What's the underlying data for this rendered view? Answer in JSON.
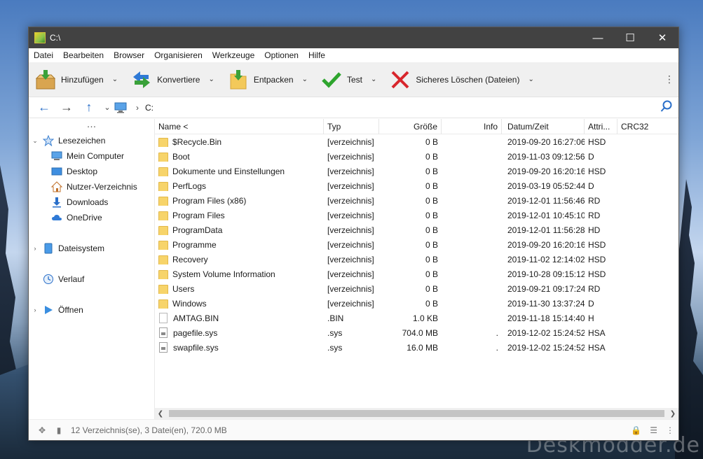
{
  "window": {
    "title": "C:\\"
  },
  "menu": [
    "Datei",
    "Bearbeiten",
    "Browser",
    "Organisieren",
    "Werkzeuge",
    "Optionen",
    "Hilfe"
  ],
  "toolbar": {
    "add_label": "Hinzufügen",
    "convert_label": "Konvertiere",
    "extract_label": "Entpacken",
    "test_label": "Test",
    "delete_label": "Sicheres Löschen (Dateien)"
  },
  "nav": {
    "path": "C:"
  },
  "sidebar": {
    "bookmarks": "Lesezeichen",
    "items": [
      "Mein Computer",
      "Desktop",
      "Nutzer-Verzeichnis",
      "Downloads",
      "OneDrive"
    ],
    "filesystem": "Dateisystem",
    "history": "Verlauf",
    "open": "Öffnen"
  },
  "columns": {
    "name": "Name <",
    "type": "Typ",
    "size": "Größe",
    "info": "Info",
    "date": "Datum/Zeit",
    "attr": "Attri...",
    "crc": "CRC32"
  },
  "files": [
    {
      "name": "$Recycle.Bin",
      "type": "[verzeichnis]",
      "size": "0 B",
      "info": "",
      "date": "2019-09-20 16:27:06",
      "attr": "HSD",
      "kind": "folder"
    },
    {
      "name": "Boot",
      "type": "[verzeichnis]",
      "size": "0 B",
      "info": "",
      "date": "2019-11-03 09:12:56",
      "attr": "D",
      "kind": "folder"
    },
    {
      "name": "Dokumente und Einstellungen",
      "type": "[verzeichnis]",
      "size": "0 B",
      "info": "",
      "date": "2019-09-20 16:20:16",
      "attr": "HSD",
      "kind": "folder"
    },
    {
      "name": "PerfLogs",
      "type": "[verzeichnis]",
      "size": "0 B",
      "info": "",
      "date": "2019-03-19 05:52:44",
      "attr": "D",
      "kind": "folder"
    },
    {
      "name": "Program Files (x86)",
      "type": "[verzeichnis]",
      "size": "0 B",
      "info": "",
      "date": "2019-12-01 11:56:46",
      "attr": "RD",
      "kind": "folder"
    },
    {
      "name": "Program Files",
      "type": "[verzeichnis]",
      "size": "0 B",
      "info": "",
      "date": "2019-12-01 10:45:10",
      "attr": "RD",
      "kind": "folder"
    },
    {
      "name": "ProgramData",
      "type": "[verzeichnis]",
      "size": "0 B",
      "info": "",
      "date": "2019-12-01 11:56:28",
      "attr": "HD",
      "kind": "folder"
    },
    {
      "name": "Programme",
      "type": "[verzeichnis]",
      "size": "0 B",
      "info": "",
      "date": "2019-09-20 16:20:16",
      "attr": "HSD",
      "kind": "folder"
    },
    {
      "name": "Recovery",
      "type": "[verzeichnis]",
      "size": "0 B",
      "info": "",
      "date": "2019-11-02 12:14:02",
      "attr": "HSD",
      "kind": "folder"
    },
    {
      "name": "System Volume Information",
      "type": "[verzeichnis]",
      "size": "0 B",
      "info": "",
      "date": "2019-10-28 09:15:12",
      "attr": "HSD",
      "kind": "folder"
    },
    {
      "name": "Users",
      "type": "[verzeichnis]",
      "size": "0 B",
      "info": "",
      "date": "2019-09-21 09:17:24",
      "attr": "RD",
      "kind": "folder"
    },
    {
      "name": "Windows",
      "type": "[verzeichnis]",
      "size": "0 B",
      "info": "",
      "date": "2019-11-30 13:37:24",
      "attr": "D",
      "kind": "folder"
    },
    {
      "name": "AMTAG.BIN",
      "type": ".BIN",
      "size": "1.0 KB",
      "info": "",
      "date": "2019-11-18 15:14:40",
      "attr": "H",
      "kind": "file"
    },
    {
      "name": "pagefile.sys",
      "type": ".sys",
      "size": "704.0 MB",
      "info": ".",
      "date": "2019-12-02 15:24:52",
      "attr": "HSA",
      "kind": "sys"
    },
    {
      "name": "swapfile.sys",
      "type": ".sys",
      "size": "16.0 MB",
      "info": ".",
      "date": "2019-12-02 15:24:52",
      "attr": "HSA",
      "kind": "sys"
    }
  ],
  "status": {
    "text": "12 Verzeichnis(se), 3 Datei(en), 720.0 MB"
  },
  "watermark": "Deskmodder.de"
}
